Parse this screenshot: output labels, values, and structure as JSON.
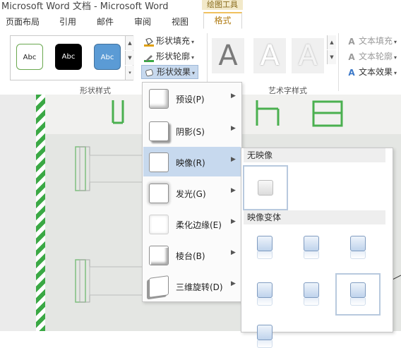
{
  "window": {
    "title": "Microsoft Word 文档 - Microsoft Word",
    "context_tab_group": "绘图工具"
  },
  "tabs": [
    "页面布局",
    "引用",
    "邮件",
    "审阅",
    "视图"
  ],
  "active_tab": "格式",
  "ribbon": {
    "shape_styles": {
      "swatches": [
        "Abc",
        "Abc",
        "Abc"
      ],
      "fill": "形状填充",
      "outline": "形状轮廓",
      "effects": "形状效果",
      "group_label": "形状样式"
    },
    "wordart_styles": {
      "letters": [
        "A",
        "A",
        "A"
      ],
      "text_fill": "文本填充",
      "text_outline": "文本轮廓",
      "text_effects": "文本效果",
      "group_label": "艺术字样式"
    }
  },
  "effects_menu": {
    "items": [
      {
        "label": "预设(P)",
        "icon": "preset-icon"
      },
      {
        "label": "阴影(S)",
        "icon": "shadow-icon"
      },
      {
        "label": "映像(R)",
        "icon": "reflection-icon",
        "active": true
      },
      {
        "label": "发光(G)",
        "icon": "glow-icon"
      },
      {
        "label": "柔化边缘(E)",
        "icon": "soft-edges-icon"
      },
      {
        "label": "棱台(B)",
        "icon": "bevel-icon"
      },
      {
        "label": "三维旋转(D)",
        "icon": "3d-rotation-icon"
      }
    ]
  },
  "reflection_submenu": {
    "no_reflection": "无映像",
    "variations": "映像变体"
  },
  "colors": {
    "accent": "#c7d9ee",
    "context_tab": "#f2e9c9",
    "stripe_green": "#3aa844"
  }
}
